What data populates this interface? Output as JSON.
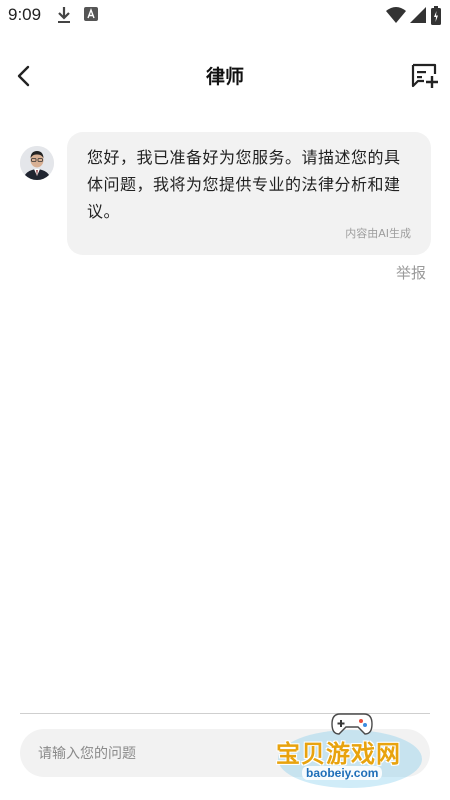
{
  "status_bar": {
    "time": "9:09",
    "icons": [
      "download-icon",
      "app-notification-icon",
      "wifi-icon",
      "signal-icon",
      "battery-icon"
    ]
  },
  "header": {
    "title": "律师",
    "back_icon": "chevron-left-icon",
    "new_chat_icon": "new-chat-icon"
  },
  "conversation": {
    "messages": [
      {
        "sender": "lawyer-assistant",
        "text": "您好，我已准备好为您服务。请描述您的具体问题，我将为您提供专业的法律分析和建议。",
        "note": "内容由AI生成"
      }
    ],
    "report_label": "举报"
  },
  "composer": {
    "placeholder": "请输入您的问题"
  },
  "watermark": {
    "text": "宝贝游戏网",
    "url": "baobeiy.com"
  },
  "colors": {
    "bubble_bg": "#f2f2f2",
    "input_bg": "#f2f2f2",
    "muted_text": "#9e9e9e"
  }
}
